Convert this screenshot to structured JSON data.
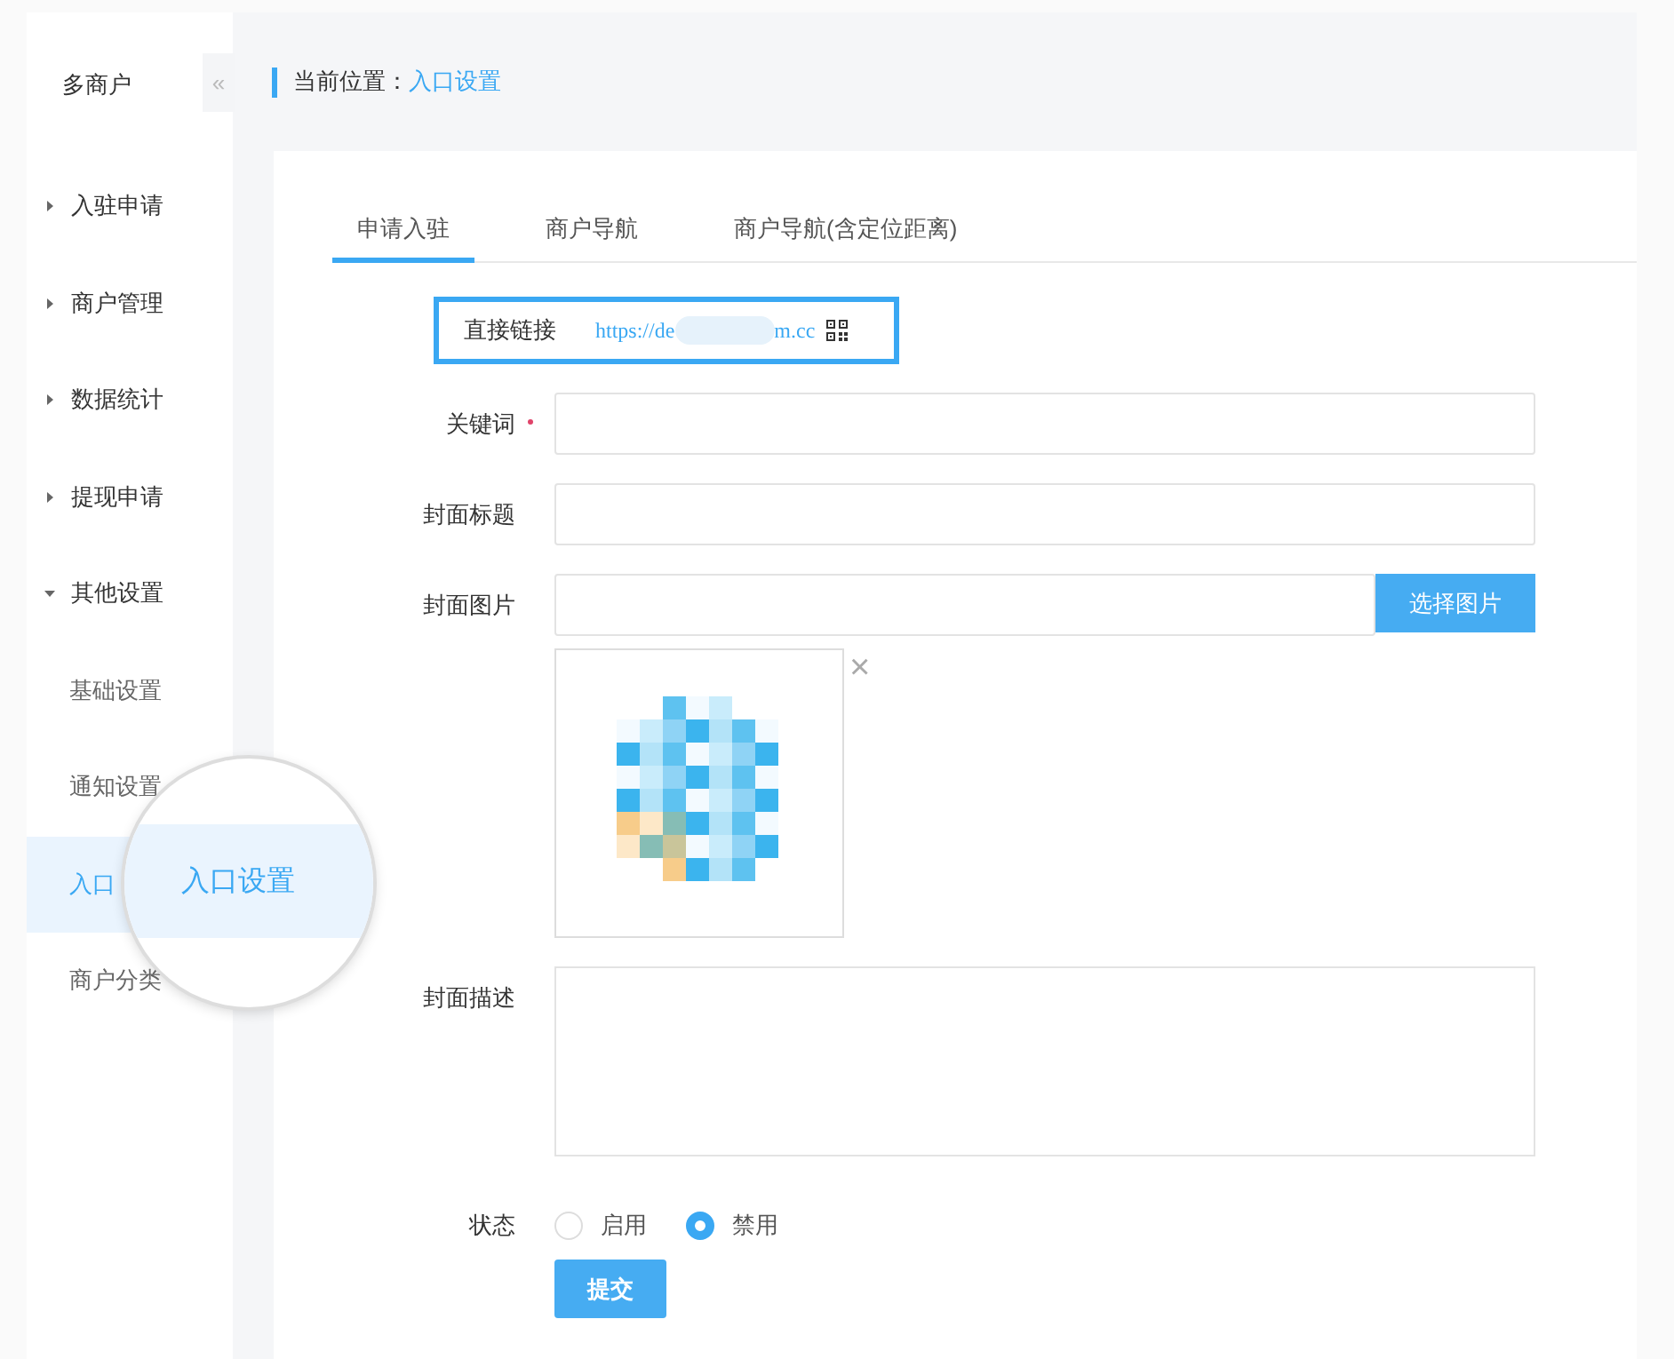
{
  "sidebar": {
    "title": "多商户",
    "collapse": "«",
    "items": [
      {
        "label": "入驻申请",
        "expanded": false
      },
      {
        "label": "商户管理",
        "expanded": false
      },
      {
        "label": "数据统计",
        "expanded": false
      },
      {
        "label": "提现申请",
        "expanded": false
      },
      {
        "label": "其他设置",
        "expanded": true,
        "children": [
          {
            "label": "基础设置",
            "selected": false
          },
          {
            "label": "通知设置",
            "selected": false
          },
          {
            "label": "入口",
            "selected": true
          },
          {
            "label": "商户分类",
            "selected": false
          }
        ]
      }
    ]
  },
  "magnifier": {
    "items": [
      {
        "label": "入口设置",
        "selected": true
      }
    ]
  },
  "breadcrumb": {
    "label": "当前位置：",
    "current": "入口设置"
  },
  "tabs": [
    {
      "label": "申请入驻",
      "selected": true
    },
    {
      "label": "商户导航",
      "selected": false
    },
    {
      "label": "商户导航(含定位距离)",
      "selected": false
    }
  ],
  "form": {
    "link": {
      "label": "直接链接",
      "url_start": "https://de",
      "url_end": "m.cc"
    },
    "fields": [
      {
        "kind": "input",
        "label": "关键词",
        "required": true
      },
      {
        "kind": "input",
        "label": "封面标题",
        "required": false
      },
      {
        "label": "封面图片",
        "required": false,
        "button": "选择图片",
        "remove": "×"
      },
      {
        "kind": "textarea",
        "label": "封面描述",
        "required": false
      },
      {
        "kind": "radio",
        "label": "状态",
        "required": false,
        "options": [
          {
            "label": "启用",
            "selected": false
          },
          {
            "label": "禁用",
            "selected": true
          }
        ]
      }
    ],
    "submit": "提交"
  }
}
